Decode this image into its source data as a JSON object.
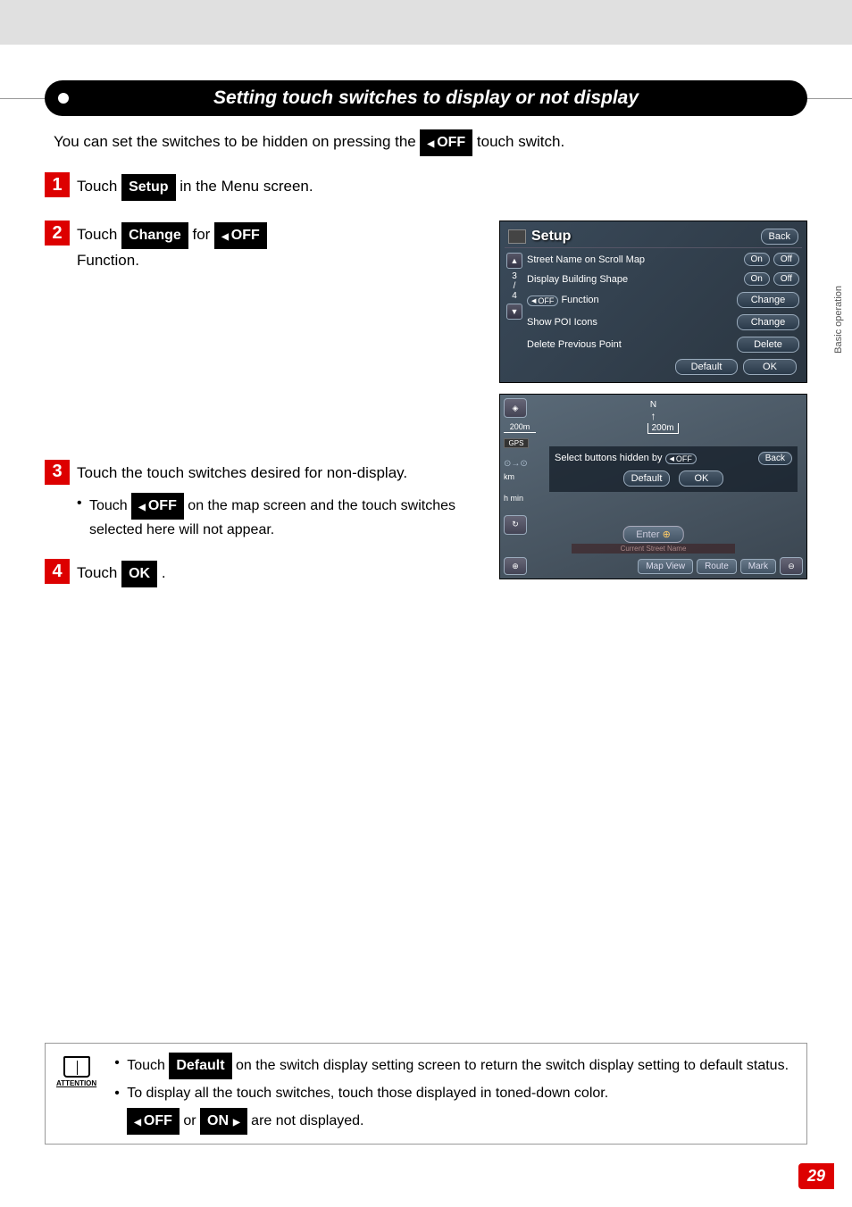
{
  "side_tab": "Basic\noperation",
  "section_title": "Setting touch switches to display or not display",
  "intro": {
    "before": "You can set the switches to be hidden on pressing the ",
    "off_btn": "OFF",
    "after": " touch switch."
  },
  "steps": {
    "s1": {
      "num": "1",
      "t1": "Touch ",
      "btn": "Setup",
      "t2": " in the Menu screen."
    },
    "s2": {
      "num": "2",
      "t1": "Touch ",
      "btn1": "Change",
      "t2": " for ",
      "btn2": "OFF",
      "t3": "Function."
    },
    "s3": {
      "num": "3",
      "text": "Touch the touch switches desired for non-display.",
      "bullet_a": "Touch ",
      "bullet_btn": "OFF",
      "bullet_b": " on the map screen and the touch switches selected here will not appear."
    },
    "s4": {
      "num": "4",
      "t1": "Touch ",
      "btn": "OK",
      "t2": " ."
    }
  },
  "setup_screen": {
    "title": "Setup",
    "back": "Back",
    "page_indicator": "3\n/\n4",
    "rows": {
      "r1": {
        "label": "Street Name on Scroll Map",
        "on": "On",
        "off": "Off"
      },
      "r2": {
        "label": "Display Building Shape",
        "on": "On",
        "off": "Off"
      },
      "r3": {
        "off_pill": "OFF",
        "label": " Function",
        "btn": "Change"
      },
      "r4": {
        "label": "Show POI Icons",
        "btn": "Change"
      },
      "r5": {
        "label": "Delete Previous Point",
        "btn": "Delete"
      }
    },
    "default": "Default",
    "ok": "OK"
  },
  "map_screen": {
    "scale": "200m",
    "gps": "GPS",
    "compass": "N",
    "km": "km",
    "hmin": "h min",
    "scale_center": "200m",
    "dialog_text": "Select buttons hidden by ",
    "dialog_pill": "OFF",
    "back": "Back",
    "default": "Default",
    "ok": "OK",
    "enter": "Enter",
    "street": "Current Street Name",
    "map_view": "Map View",
    "route": "Route",
    "mark": "Mark"
  },
  "attention": {
    "label": "ATTENTION",
    "b1a": "Touch ",
    "b1btn": "Default",
    "b1b": " on the switch display setting screen to return the switch display setting to default status.",
    "b2": "To display all the touch switches, touch those displayed in toned-down color.",
    "b3_off": "OFF",
    "b3_mid": " or ",
    "b3_on": "ON",
    "b3_end": " are not displayed."
  },
  "page_number": "29"
}
